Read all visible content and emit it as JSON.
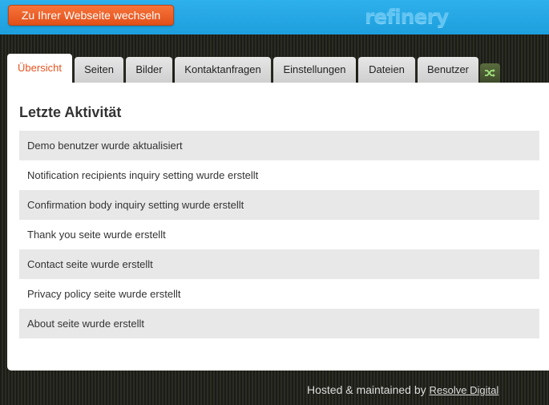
{
  "header": {
    "site_button_label": "Zu Ihrer Webseite wechseln",
    "logo_text": "refinery"
  },
  "tabs": [
    {
      "label": "Übersicht",
      "active": true
    },
    {
      "label": "Seiten"
    },
    {
      "label": "Bilder"
    },
    {
      "label": "Kontaktanfragen"
    },
    {
      "label": "Einstellungen"
    },
    {
      "label": "Dateien"
    },
    {
      "label": "Benutzer"
    }
  ],
  "tab_icon": "shuffle-icon",
  "main": {
    "heading": "Letzte Aktivität",
    "activities": [
      "Demo benutzer wurde aktualisiert",
      "Notification recipients inquiry setting wurde erstellt",
      "Confirmation body inquiry setting wurde erstellt",
      "Thank you seite wurde erstellt",
      "Contact seite wurde erstellt",
      "Privacy policy seite wurde erstellt",
      "About seite wurde erstellt"
    ]
  },
  "footer": {
    "text": "Hosted & maintained by",
    "link_label": "Resolve Digital"
  },
  "colors": {
    "header_blue": "#25a8e6",
    "button_orange": "#e85a22",
    "active_tab_text": "#e4531f",
    "row_stripe": "#e8e8e8"
  }
}
